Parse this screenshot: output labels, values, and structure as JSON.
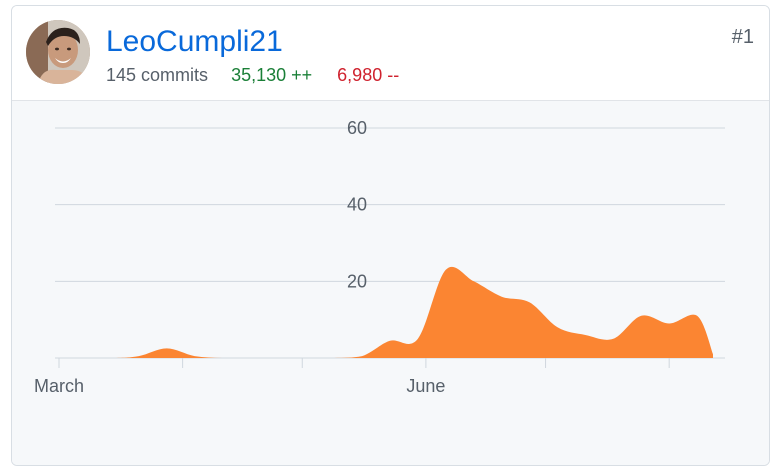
{
  "contributor": {
    "username": "LeoCumpli21",
    "rank": "#1",
    "commits": "145 commits",
    "additions": "35,130 ++",
    "deletions": "6,980 --",
    "avatar_icon": "user-avatar-photo"
  },
  "colors": {
    "link": "#0969da",
    "additions": "#1a7f37",
    "deletions": "#cf222e",
    "area_fill": "#fb8532",
    "chart_background": "#f6f8fa",
    "grid": "#d0d7de"
  },
  "chart_data": {
    "type": "area",
    "y_ticks": [
      "60",
      "40",
      "20"
    ],
    "x_tick_labels": [
      "March",
      "June"
    ],
    "ylim": [
      0,
      60
    ],
    "xlim": [
      "2021-02-28",
      "2021-08-15"
    ],
    "grid": true,
    "x": [
      "2021-02-28",
      "2021-03-14",
      "2021-03-21",
      "2021-03-28",
      "2021-04-04",
      "2021-04-11",
      "2021-04-18",
      "2021-04-25",
      "2021-05-02",
      "2021-05-09",
      "2021-05-16",
      "2021-05-23",
      "2021-05-30",
      "2021-06-06",
      "2021-06-13",
      "2021-06-20",
      "2021-06-27",
      "2021-07-04",
      "2021-07-11",
      "2021-07-18",
      "2021-07-25",
      "2021-08-01",
      "2021-08-08",
      "2021-08-12"
    ],
    "series": [
      {
        "values": [
          0,
          0,
          0.5,
          2.5,
          0.5,
          0,
          0,
          0,
          0,
          0,
          0.5,
          4.5,
          5,
          23,
          20,
          16,
          14.5,
          8,
          6,
          5,
          11,
          9,
          11,
          1
        ]
      }
    ]
  }
}
